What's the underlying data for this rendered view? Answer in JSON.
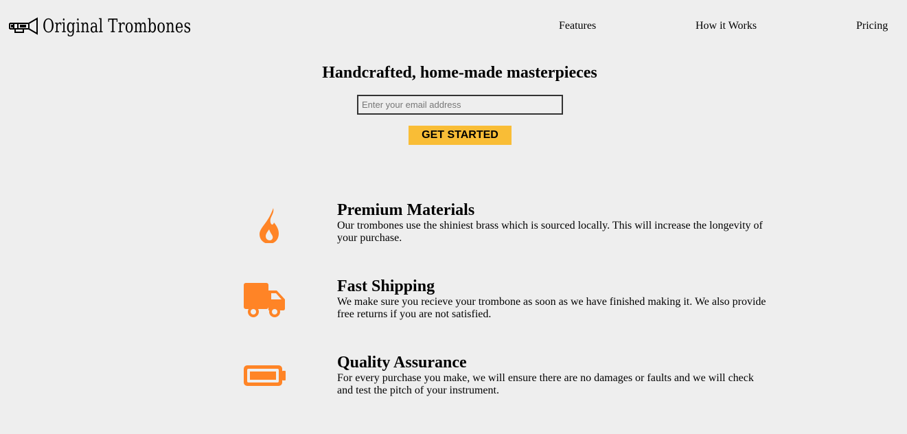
{
  "header": {
    "brand": "Original Trombones",
    "nav": {
      "features": "Features",
      "how_it_works": "How it Works",
      "pricing": "Pricing"
    }
  },
  "hero": {
    "title": "Handcrafted, home-made masterpieces",
    "email_placeholder": "Enter your email address",
    "email_value": "",
    "cta_label": "GET STARTED"
  },
  "features": [
    {
      "icon": "fire-icon",
      "title": "Premium Materials",
      "description": "Our trombones use the shiniest brass which is sourced locally. This will increase the longevity of your purchase."
    },
    {
      "icon": "truck-icon",
      "title": "Fast Shipping",
      "description": "We make sure you recieve your trombone as soon as we have finished making it. We also provide free returns if you are not satisfied."
    },
    {
      "icon": "battery-full-icon",
      "title": "Quality Assurance",
      "description": "For every purchase you make, we will ensure there are no damages or faults and we will check and test the pitch of your instrument."
    }
  ],
  "colors": {
    "background": "#eeeeee",
    "accent": "#f9bd36",
    "icon": "#ff8426"
  }
}
